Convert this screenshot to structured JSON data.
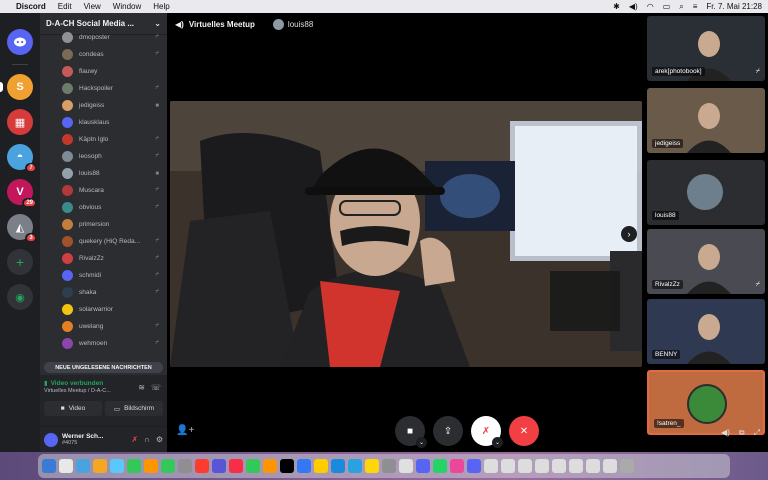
{
  "menubar": {
    "app": "Discord",
    "menus": [
      "Edit",
      "View",
      "Window",
      "Help"
    ],
    "clock": "Fr. 7. Mai  21:28"
  },
  "server_rail": {
    "servers": [
      {
        "name": "discord-home",
        "color": "#5865f2",
        "badge": ""
      },
      {
        "name": "server-orange",
        "color": "#f0a030",
        "badge": ""
      },
      {
        "name": "server-flag",
        "color": "#d63b3b",
        "badge": ""
      },
      {
        "name": "server-hat",
        "color": "#4aa3df",
        "badge": "7"
      },
      {
        "name": "server-v",
        "color": "#c2185b",
        "badge": "29"
      },
      {
        "name": "server-bird",
        "color": "#7b7f87",
        "badge": "3"
      }
    ]
  },
  "sidebar": {
    "guild_name": "D-A-CH Social Media ...",
    "members": [
      {
        "name": "dmoposter",
        "color": "#8e9297",
        "status": "mic-off"
      },
      {
        "name": "condeas",
        "color": "#7a6a58",
        "status": "mic-off"
      },
      {
        "name": "flauwy",
        "color": "#c65a5a",
        "status": ""
      },
      {
        "name": "Hackspoiler",
        "color": "#6d7b6a",
        "status": "mic-off"
      },
      {
        "name": "jedigeiss",
        "color": "#d9a066",
        "status": "video"
      },
      {
        "name": "klausklaus",
        "color": "#5865f2",
        "status": ""
      },
      {
        "name": "Käptn Iglo",
        "color": "#c0392b",
        "status": "mic-off"
      },
      {
        "name": "leosoph",
        "color": "#7d8b95",
        "status": "mic-off"
      },
      {
        "name": "louis88",
        "color": "#93a1ab",
        "status": "video"
      },
      {
        "name": "Muscara",
        "color": "#b03a3a",
        "status": "mic-off"
      },
      {
        "name": "obvious",
        "color": "#3b8b8b",
        "status": "mic-off"
      },
      {
        "name": "primersion",
        "color": "#c47d3a",
        "status": ""
      },
      {
        "name": "quekery (HiQ Reda...",
        "color": "#a0522d",
        "status": "mic-off"
      },
      {
        "name": "RivalzZz",
        "color": "#d04040",
        "status": "mic-off"
      },
      {
        "name": "schmidi",
        "color": "#5865f2",
        "status": "mic-off"
      },
      {
        "name": "shaka",
        "color": "#2c3e50",
        "status": "mic-off"
      },
      {
        "name": "solarwarrior",
        "color": "#f1c40f",
        "status": ""
      },
      {
        "name": "uwelang",
        "color": "#e67e22",
        "status": "mic-off"
      },
      {
        "name": "wehmoen",
        "color": "#8e44ad",
        "status": "mic-off"
      }
    ],
    "unread_button": "NEUE UNGELESENE NACHRICHTEN",
    "voice": {
      "status": "Video verbunden",
      "channel": "Virtuelles Meetup / D-A-C...",
      "video_label": "Video",
      "screen_label": "Bildschirm"
    },
    "user": {
      "name": "Werner Sch...",
      "tag": "#4075"
    }
  },
  "stage": {
    "channel": "Virtuelles Meetup",
    "focused_user": "louis88"
  },
  "tiles": [
    {
      "label": "arek[photobook]",
      "muted": true,
      "active": false,
      "avatar": false,
      "bg": "#2a2f36"
    },
    {
      "label": "jedigeiss",
      "muted": false,
      "active": false,
      "avatar": false,
      "bg": "#6a5a4a"
    },
    {
      "label": "louis88",
      "muted": false,
      "active": false,
      "avatar": true,
      "bg": "#2b2d31"
    },
    {
      "label": "RivalzZz",
      "muted": true,
      "active": false,
      "avatar": false,
      "bg": "#4a4a52"
    },
    {
      "label": "BENNY",
      "muted": false,
      "active": false,
      "avatar": false,
      "bg": "#2f3a52"
    },
    {
      "label": "!satren_",
      "muted": false,
      "active": true,
      "avatar": true,
      "bg": "#c06a40"
    }
  ]
}
